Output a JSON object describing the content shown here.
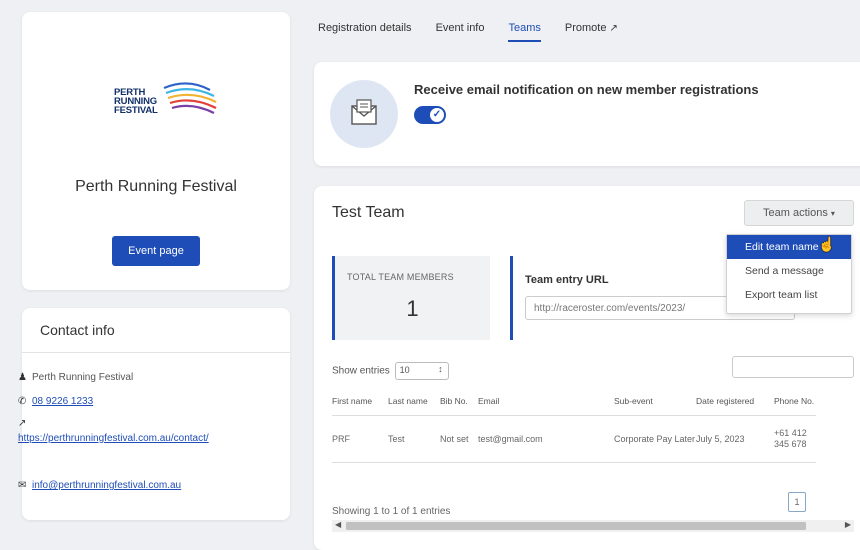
{
  "event": {
    "logo_lines": [
      "PERTH",
      "RUNNING",
      "FESTIVAL"
    ],
    "name": "Perth Running Festival",
    "event_page_button": "Event page"
  },
  "contact": {
    "title": "Contact info",
    "name": "Perth Running Festival",
    "phone": "08 9226 1233",
    "website": "https://perthrunningfestival.com.au/contact/",
    "email": "info@perthrunningfestival.com.au",
    "icons": [
      "user-icon",
      "phone-icon",
      "external-link-icon",
      "email-icon"
    ]
  },
  "tabs": [
    {
      "label": "Registration details",
      "active": false
    },
    {
      "label": "Event info",
      "active": false
    },
    {
      "label": "Teams",
      "active": true
    },
    {
      "label": "Promote",
      "active": false
    }
  ],
  "notification": {
    "text": "Receive email notification on new member registrations",
    "enabled": true
  },
  "team": {
    "name": "Test Team",
    "actions_label": "Team actions",
    "total_label": "TOTAL TEAM MEMBERS",
    "total_value": "1",
    "url_label": "Team entry URL",
    "url_value": "http://raceroster.com/events/2023/",
    "show_entries_label": "Show entries",
    "show_entries_value": "10",
    "showing_text": "Showing 1 to 1 of 1 entries",
    "page": "1"
  },
  "table": {
    "headers": [
      "First name",
      "Last name",
      "Bib No.",
      "Email",
      "Sub-event",
      "Date registered",
      "Phone No."
    ],
    "rows": [
      [
        "PRF",
        "Test",
        "Not set",
        "test@gmail.com",
        "Corporate Pay Later",
        "July 5, 2023",
        "+61 412 345 678"
      ]
    ]
  },
  "dropdown": {
    "items": [
      "Edit team name",
      "Send a message",
      "Export team list"
    ],
    "active_index": 0
  },
  "colors": {
    "primary": "#1e4db7",
    "background": "#eef0f3"
  }
}
